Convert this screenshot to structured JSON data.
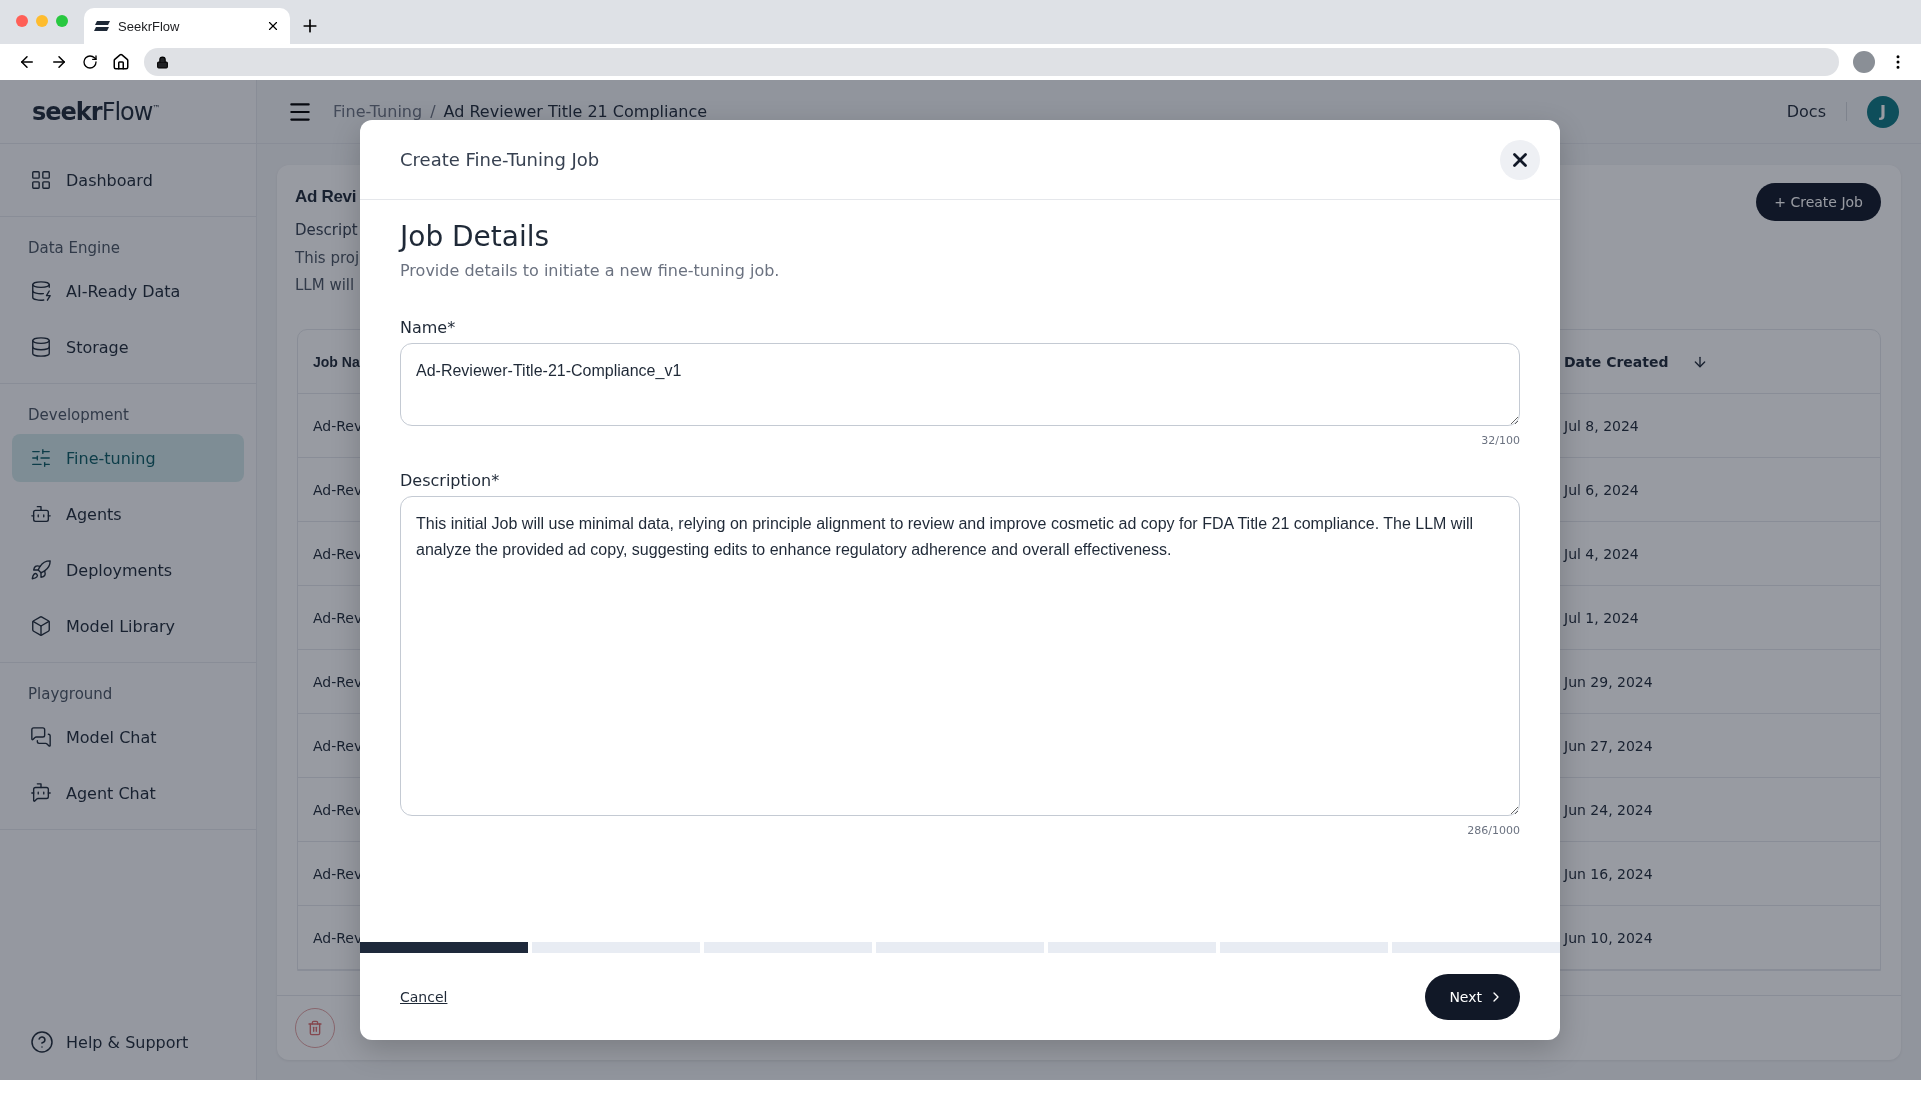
{
  "browser": {
    "tab_title": "SeekrFlow"
  },
  "logo": "**seekr**Flow$^{™}$",
  "header": {
    "breadcrumbs": [
      {
        "label": "Fine-Tuning",
        "current": false
      },
      {
        "label": "Ad Reviewer Title 21 Compliance",
        "current": true
      }
    ],
    "separator": "/",
    "docs": "Docs",
    "avatar": "J"
  },
  "sidebar": {
    "items": [
      {
        "label": "Dashboard",
        "selected": false
      }
    ],
    "sections": [
      {
        "heading": "Data Engine",
        "items": [
          {
            "label": "AI-Ready Data",
            "selected": false
          },
          {
            "label": "Storage",
            "selected": false
          }
        ]
      },
      {
        "heading": "Development",
        "items": [
          {
            "label": "Fine-tuning",
            "selected": true
          },
          {
            "label": "Agents",
            "selected": false
          },
          {
            "label": "Deployments",
            "selected": false
          },
          {
            "label": "Model Library",
            "selected": false
          }
        ]
      },
      {
        "heading": "Playground",
        "items": [
          {
            "label": "Model Chat",
            "selected": false
          },
          {
            "label": "Agent Chat",
            "selected": false
          }
        ]
      }
    ],
    "footer_link": "Help & Support"
  },
  "project": {
    "title": "Ad Revi",
    "description_label": "Descript",
    "description_lines": [
      "This proj",
      "LLM will"
    ],
    "create_button": "+ Create Job",
    "table": {
      "columns": [
        "Job Na",
        "Date Created"
      ],
      "rows": [
        {
          "column_1": "Ad-Rev",
          "date": "Jul 8, 2024"
        },
        {
          "column_1": "Ad-Rev",
          "date": "Jul 6, 2024"
        },
        {
          "column_1": "Ad-Rev",
          "date": "Jul 4, 2024"
        },
        {
          "column_1": "Ad-Rev",
          "date": "Jul 1, 2024"
        },
        {
          "column_1": "Ad-Rev",
          "date": "Jun 29, 2024"
        },
        {
          "column_1": "Ad-Rev",
          "date": "Jun 27, 2024"
        },
        {
          "column_1": "Ad-Rev",
          "date": "Jun 24, 2024"
        },
        {
          "column_1": "Ad-Rev",
          "date": "Jun 16, 2024"
        },
        {
          "column_1": "Ad-Rev",
          "date": "Jun 10, 2024"
        }
      ]
    }
  },
  "modal": {
    "title": "Create Fine-Tuning Job",
    "heading": "Job Details",
    "subtitle": "Provide details to initiate a new fine-tuning job.",
    "fields": [
      {
        "kind": "single",
        "label": "Name*",
        "value": "Ad-Reviewer-Title-21-Compliance_v1",
        "counter": "32/100"
      },
      {
        "kind": "multi",
        "label": "Description*",
        "value": "This initial Job will use minimal data, relying on principle alignment to review and improve cosmetic ad copy for FDA Title 21 compliance. The LLM will analyze the provided ad copy, suggesting edits to enhance regulatory adherence and overall effectiveness.",
        "counter": "286/1000"
      }
    ],
    "steps": [
      {
        "selected": true
      },
      {
        "selected": false
      },
      {
        "selected": false
      },
      {
        "selected": false
      },
      {
        "selected": false
      },
      {
        "selected": false
      },
      {
        "selected": false
      }
    ],
    "cancel": "Cancel",
    "next": "Next"
  }
}
